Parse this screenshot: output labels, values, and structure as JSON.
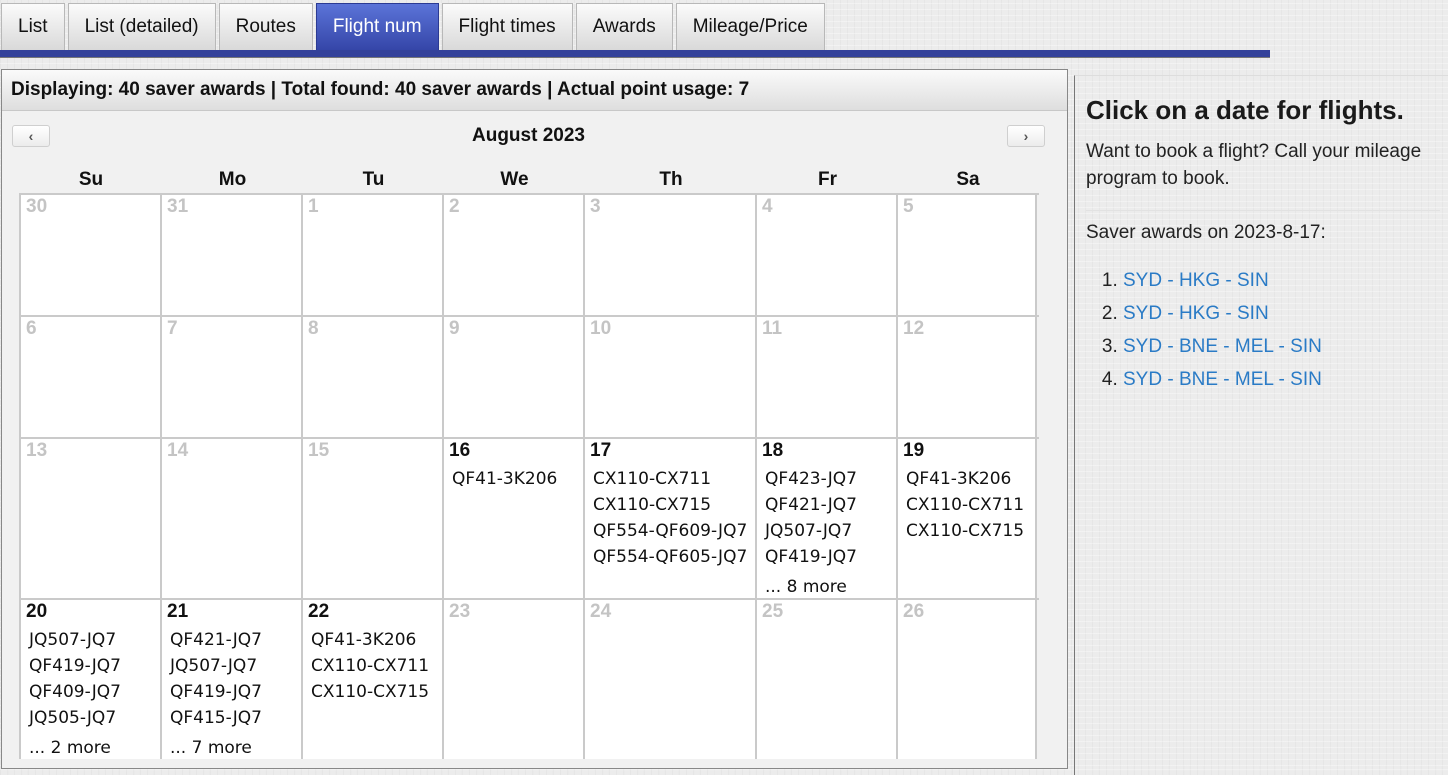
{
  "tabs": [
    {
      "label": "List",
      "active": false
    },
    {
      "label": "List (detailed)",
      "active": false
    },
    {
      "label": "Routes",
      "active": false
    },
    {
      "label": "Flight num",
      "active": true
    },
    {
      "label": "Flight times",
      "active": false
    },
    {
      "label": "Awards",
      "active": false
    },
    {
      "label": "Mileage/Price",
      "active": false
    }
  ],
  "summary": "Displaying: 40 saver awards | Total found: 40 saver awards | Actual point usage: 7",
  "calendar": {
    "month_title": "August 2023",
    "prev_icon": "‹",
    "next_icon": "›",
    "weekdays": [
      "Su",
      "Mo",
      "Tu",
      "We",
      "Th",
      "Fr",
      "Sa"
    ],
    "weeks": [
      [
        {
          "day": "30",
          "active": false,
          "flights": []
        },
        {
          "day": "31",
          "active": false,
          "flights": []
        },
        {
          "day": "1",
          "active": false,
          "flights": []
        },
        {
          "day": "2",
          "active": false,
          "flights": []
        },
        {
          "day": "3",
          "active": false,
          "flights": []
        },
        {
          "day": "4",
          "active": false,
          "flights": []
        },
        {
          "day": "5",
          "active": false,
          "flights": []
        }
      ],
      [
        {
          "day": "6",
          "active": false,
          "flights": []
        },
        {
          "day": "7",
          "active": false,
          "flights": []
        },
        {
          "day": "8",
          "active": false,
          "flights": []
        },
        {
          "day": "9",
          "active": false,
          "flights": []
        },
        {
          "day": "10",
          "active": false,
          "flights": []
        },
        {
          "day": "11",
          "active": false,
          "flights": []
        },
        {
          "day": "12",
          "active": false,
          "flights": []
        }
      ],
      [
        {
          "day": "13",
          "active": false,
          "flights": []
        },
        {
          "day": "14",
          "active": false,
          "flights": []
        },
        {
          "day": "15",
          "active": false,
          "flights": []
        },
        {
          "day": "16",
          "active": true,
          "flights": [
            "QF41-3K206"
          ]
        },
        {
          "day": "17",
          "active": true,
          "flights": [
            "CX110-CX711",
            "CX110-CX715",
            "QF554-QF609-JQ7",
            "QF554-QF605-JQ7"
          ]
        },
        {
          "day": "18",
          "active": true,
          "flights": [
            "QF423-JQ7",
            "QF421-JQ7",
            "JQ507-JQ7",
            "QF419-JQ7"
          ],
          "more": "... 8 more"
        },
        {
          "day": "19",
          "active": true,
          "flights": [
            "QF41-3K206",
            "CX110-CX711",
            "CX110-CX715"
          ]
        }
      ],
      [
        {
          "day": "20",
          "active": true,
          "flights": [
            "JQ507-JQ7",
            "QF419-JQ7",
            "QF409-JQ7",
            "JQ505-JQ7"
          ],
          "more": "... 2 more"
        },
        {
          "day": "21",
          "active": true,
          "flights": [
            "QF421-JQ7",
            "JQ507-JQ7",
            "QF419-JQ7",
            "QF415-JQ7"
          ],
          "more": "... 7 more"
        },
        {
          "day": "22",
          "active": true,
          "flights": [
            "QF41-3K206",
            "CX110-CX711",
            "CX110-CX715"
          ]
        },
        {
          "day": "23",
          "active": false,
          "flights": []
        },
        {
          "day": "24",
          "active": false,
          "flights": []
        },
        {
          "day": "25",
          "active": false,
          "flights": []
        },
        {
          "day": "26",
          "active": false,
          "flights": []
        }
      ]
    ]
  },
  "side": {
    "title": "Click on a date for flights.",
    "intro": "Want to book a flight? Call your mileage program to book.",
    "awards_title": "Saver awards on 2023-8-17:",
    "routes": [
      "SYD - HKG - SIN",
      "SYD - HKG - SIN",
      "SYD - BNE - MEL - SIN",
      "SYD - BNE - MEL - SIN"
    ]
  },
  "colors": {
    "active_tab": "#3a4db0",
    "tab_underline": "#33419a",
    "link": "#2a7bc6",
    "inactive_day": "#c4c4c4"
  }
}
